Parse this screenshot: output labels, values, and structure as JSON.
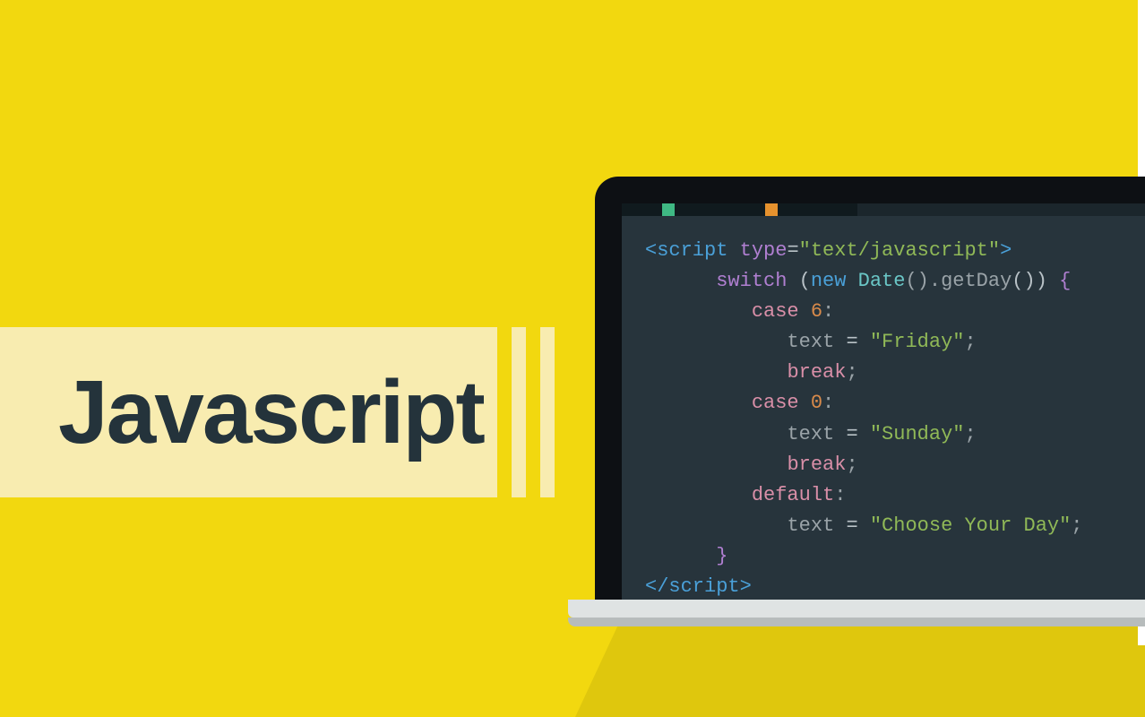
{
  "title": "Javascript",
  "code": {
    "line1": {
      "open": "<script",
      "attr": "type",
      "eq": "=",
      "val": "\"text/javascript\"",
      "close": ">"
    },
    "line2": {
      "kw": "switch",
      "lp": " (",
      "new": "new ",
      "type": "Date",
      "call": "().",
      "method": "getDay",
      "rp": "()) ",
      "brace": "{"
    },
    "line3": {
      "kw": "case",
      "sp": " ",
      "num": "6",
      "colon": ":"
    },
    "line4": {
      "var": "text",
      "eq": " = ",
      "str": "\"Friday\"",
      "semi": ";"
    },
    "line5": {
      "kw": "break",
      "semi": ";"
    },
    "line6": {
      "kw": "case",
      "sp": " ",
      "num": "0",
      "colon": ":"
    },
    "line7": {
      "var": "text",
      "eq": " = ",
      "str": "\"Sunday\"",
      "semi": ";"
    },
    "line8": {
      "kw": "break",
      "semi": ";"
    },
    "line9": {
      "kw": "default",
      "colon": ":"
    },
    "line10": {
      "var": "text",
      "eq": " = ",
      "str": "\"Choose Your Day\"",
      "semi": ";"
    },
    "line11": {
      "brace": "}"
    },
    "line12": {
      "close": "</script",
      "gt": ">"
    }
  }
}
